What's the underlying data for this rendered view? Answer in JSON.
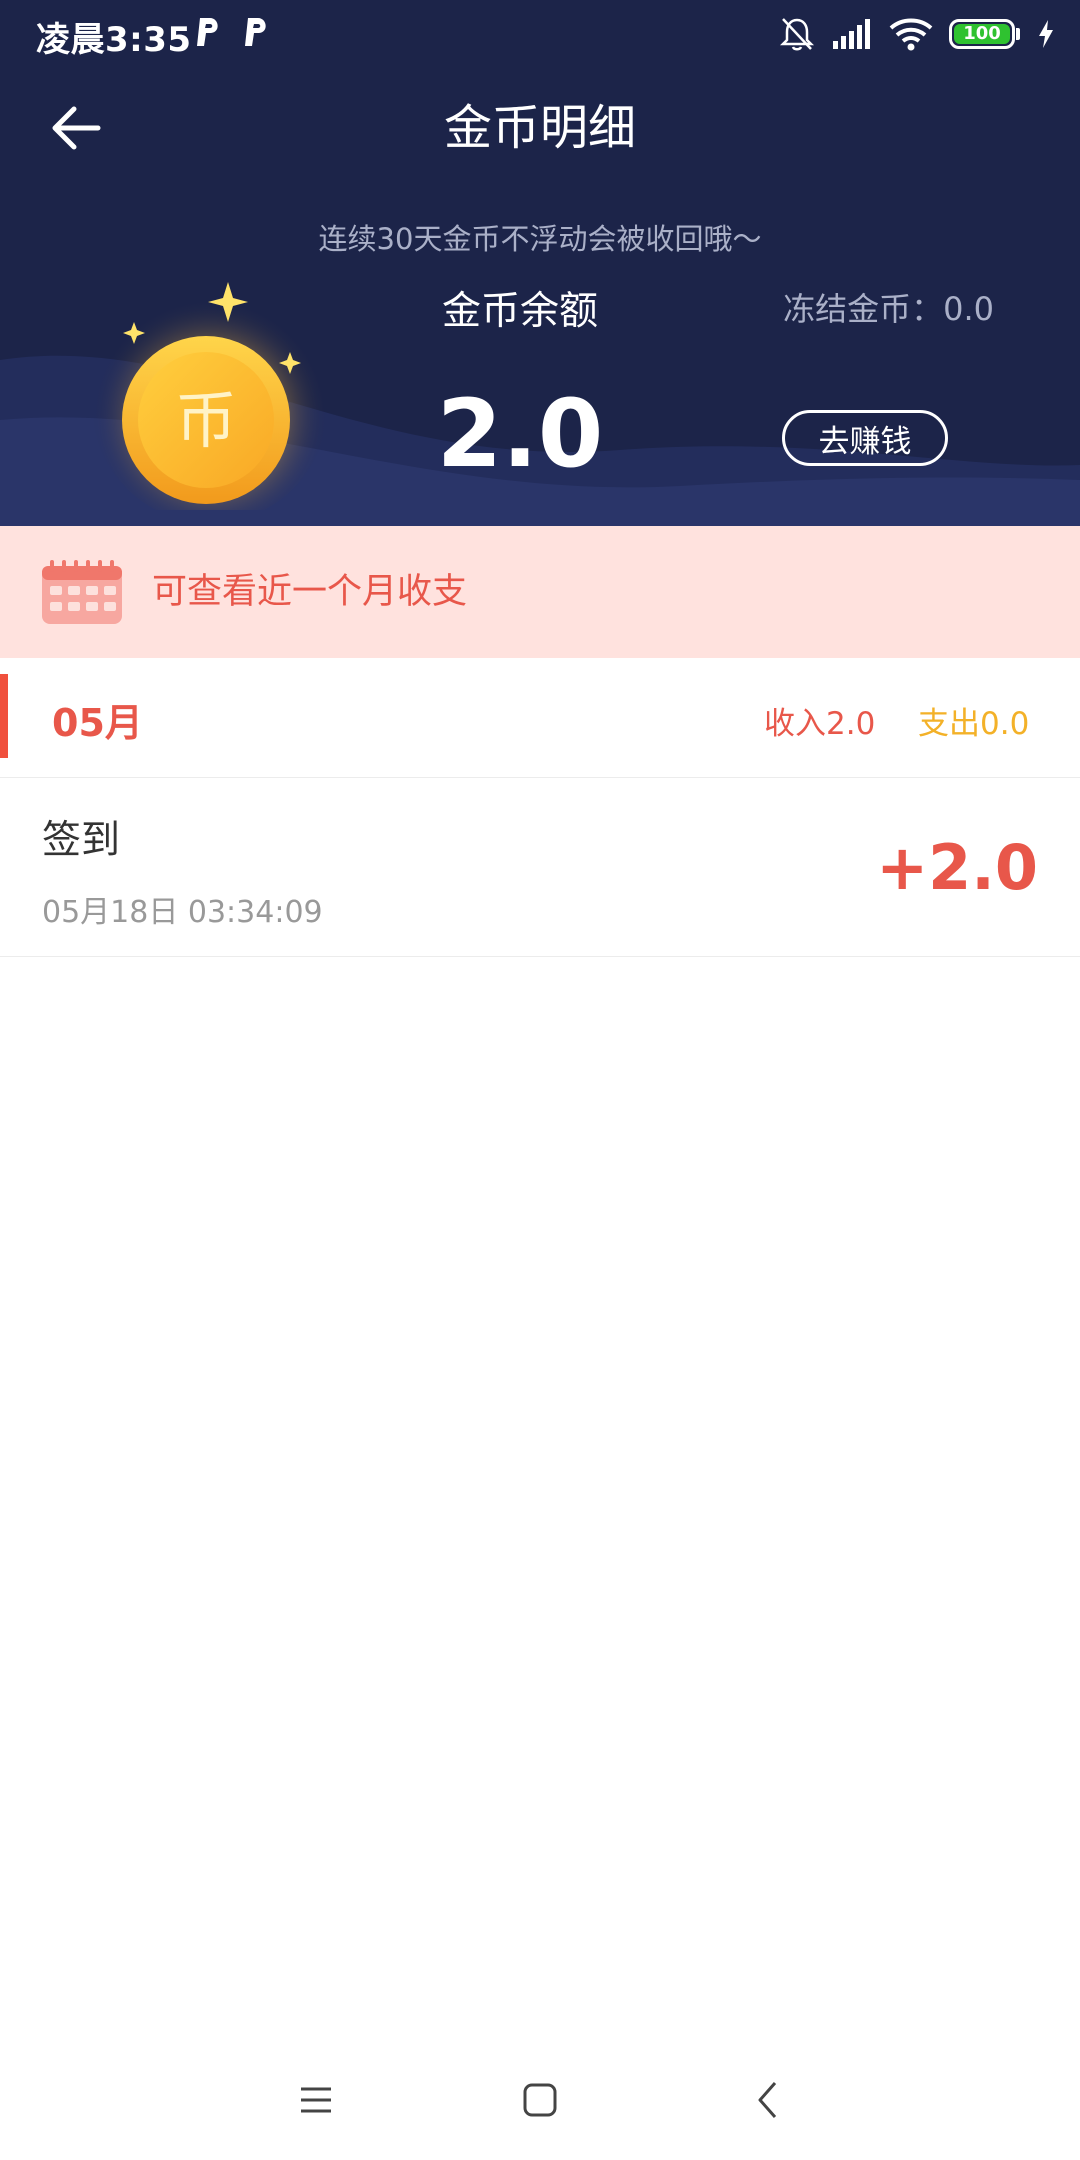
{
  "status_bar": {
    "time": "凌晨3:35",
    "battery": "100",
    "icons": [
      "p-app-icon",
      "p-app-icon",
      "bell-muted-icon",
      "signal-icon",
      "wifi-icon",
      "battery-icon",
      "charging-icon"
    ]
  },
  "header": {
    "title": "金币明细",
    "back_icon": "arrow-left-icon"
  },
  "balance": {
    "hint": "连续30天金币不浮动会被收回哦～",
    "label": "金币余额",
    "frozen": "冻结金币：0.0",
    "value": "2.0",
    "earn_button": "去赚钱",
    "coin_glyph": "币"
  },
  "banner": {
    "icon": "calendar-icon",
    "text": "可查看近一个月收支"
  },
  "month": {
    "label": "05月",
    "income": "收入2.0",
    "expense": "支出0.0"
  },
  "records": [
    {
      "title": "签到",
      "time": "05月18日 03:34:09",
      "amount": "+2.0"
    }
  ],
  "nav": {
    "icons": [
      "menu-icon",
      "home-icon",
      "back-icon"
    ]
  },
  "colors": {
    "header_bg": "#1c2449",
    "accent_red": "#e8574a",
    "expense_yellow": "#f3b128",
    "banner_bg": "#ffe2de",
    "coin_gold": "#fbb92a"
  }
}
